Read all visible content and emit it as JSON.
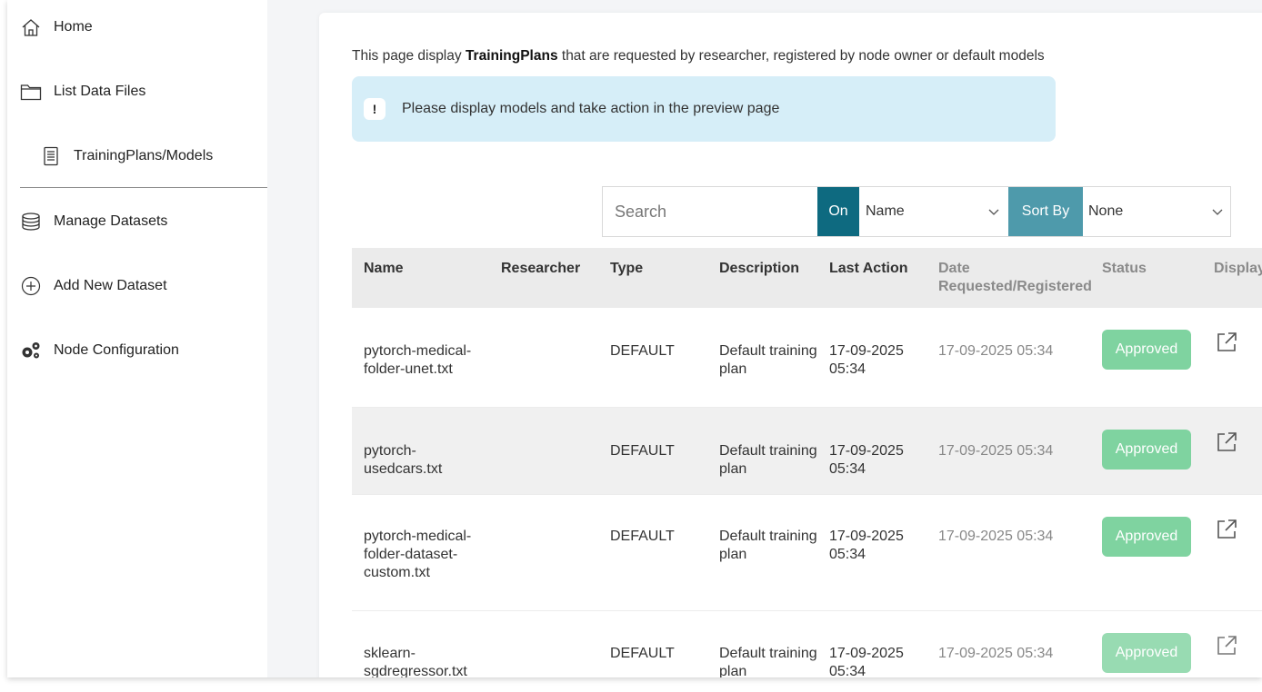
{
  "sidebar": {
    "items": [
      {
        "label": "Home",
        "icon": "home-icon"
      },
      {
        "label": "List Data Files",
        "icon": "folder-icon"
      },
      {
        "label": "TrainingPlans/Models",
        "icon": "document-icon"
      },
      {
        "label": "Manage Datasets",
        "icon": "database-icon"
      },
      {
        "label": "Add New Dataset",
        "icon": "plus-circle-icon"
      },
      {
        "label": "Node Configuration",
        "icon": "gears-icon"
      }
    ]
  },
  "main": {
    "intro_prefix": "This page display ",
    "intro_bold": "TrainingPlans",
    "intro_suffix": " that are requested by researcher, registered by node owner or default models",
    "info_badge": "!",
    "info_message": "Please display models and take action in the preview page"
  },
  "toolbar": {
    "search_placeholder": "Search",
    "on_label": "On",
    "on_value": "Name",
    "sort_label": "Sort By",
    "sort_value": "None"
  },
  "table": {
    "headers": {
      "name": "Name",
      "researcher": "Researcher",
      "type": "Type",
      "description": "Description",
      "last_action": "Last Action",
      "date_line1": "Date",
      "date_line2": "Requested/Registered",
      "status": "Status",
      "display": "Display"
    },
    "rows": [
      {
        "name": "pytorch-medical-folder-unet.txt",
        "researcher": "",
        "type": "DEFAULT",
        "description": "Default training plan",
        "last_action": "17-09-2025 05:34",
        "date": "17-09-2025 05:34",
        "status": "Approved"
      },
      {
        "name": "pytorch-usedcars.txt",
        "researcher": "",
        "type": "DEFAULT",
        "description": "Default training plan",
        "last_action": "17-09-2025 05:34",
        "date": "17-09-2025 05:34",
        "status": "Approved"
      },
      {
        "name": "pytorch-medical-folder-dataset-custom.txt",
        "researcher": "",
        "type": "DEFAULT",
        "description": "Default training plan",
        "last_action": "17-09-2025 05:34",
        "date": "17-09-2025 05:34",
        "status": "Approved"
      },
      {
        "name": "sklearn-sgdregressor.txt",
        "researcher": "",
        "type": "DEFAULT",
        "description": "Default training plan",
        "last_action": "17-09-2025 05:34",
        "date": "17-09-2025 05:34",
        "status": "Approved"
      }
    ]
  },
  "colors": {
    "accent_dark": "#0e6a80",
    "accent_light": "#4e9aab",
    "info_bg": "#d6eef8",
    "approved": "#7fd3a0"
  }
}
